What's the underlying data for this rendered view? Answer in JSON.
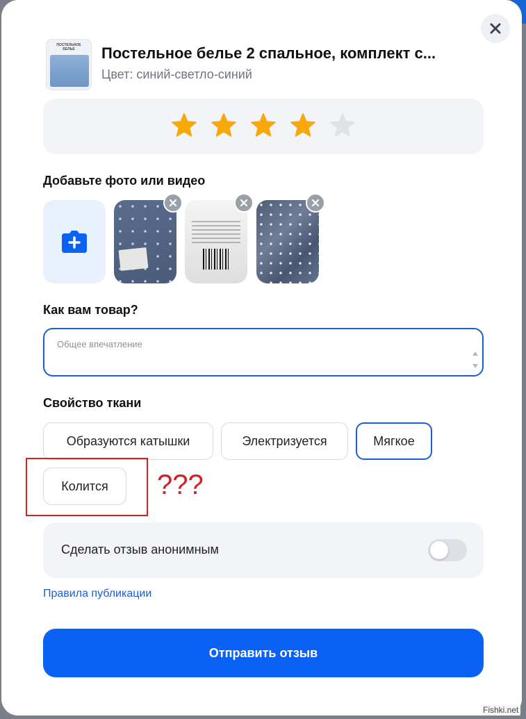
{
  "product": {
    "title": "Постельное белье 2 спальное, комплект с...",
    "color": "Цвет: синий-светло-синий",
    "thumb_label": "ПОСТЕЛЬНОЕ БЕЛЬЕ"
  },
  "rating": {
    "value": 4,
    "max": 5,
    "filled_color": "#f7a90c",
    "empty_color": "#dfe3e8"
  },
  "media": {
    "label": "Добавьте фото или видео",
    "add_icon": "camera-plus-icon",
    "photos_count": 3
  },
  "review": {
    "label": "Как вам товар?",
    "placeholder": "Общее впечатление",
    "value": ""
  },
  "fabric": {
    "label": "Свойство ткани",
    "chips": [
      {
        "label": "Образуются катышки",
        "selected": false
      },
      {
        "label": "Электризуется",
        "selected": false
      },
      {
        "label": "Мягкое",
        "selected": true
      },
      {
        "label": "Колится",
        "selected": false
      }
    ]
  },
  "annotation": {
    "text": "???",
    "color": "#d32020"
  },
  "anonymous": {
    "label": "Сделать отзыв анонимным",
    "enabled": false
  },
  "rules_link": "Правила публикации",
  "submit_label": "Отправить отзыв",
  "watermark": "Fishki.net",
  "colors": {
    "accent": "#0a62f5",
    "link": "#1a5cd6",
    "panel": "#f2f4f7"
  }
}
